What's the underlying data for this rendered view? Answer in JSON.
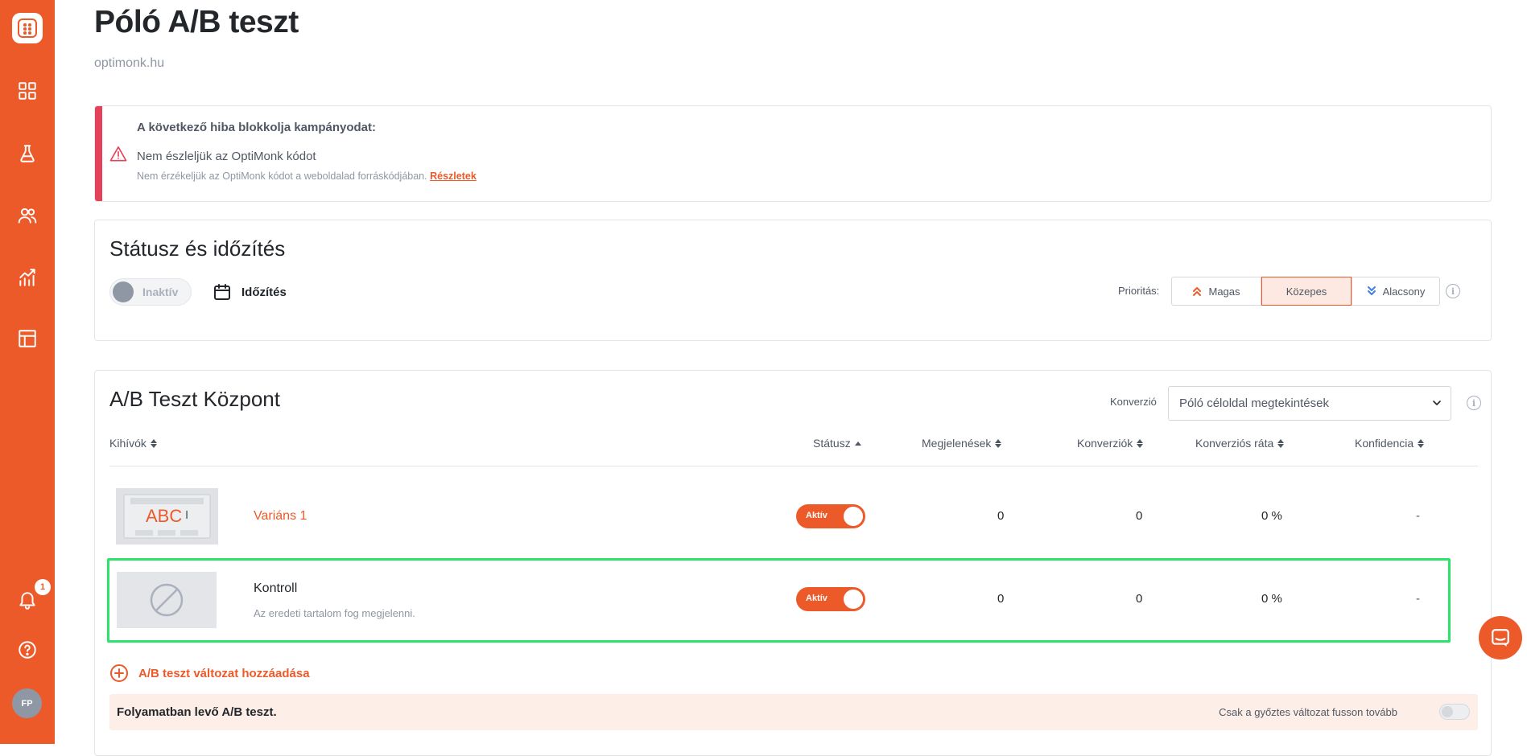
{
  "sidebar": {
    "notification_count": "1",
    "avatar_initials": "FP"
  },
  "page": {
    "title": "Póló A/B teszt",
    "domain": "optimonk.hu"
  },
  "alert": {
    "title": "A következő hiba blokkolja kampányodat:",
    "message": "Nem észleljük az OptiMonk kódot",
    "detail": "Nem érzékeljük az OptiMonk kódot a weboldalad forráskódjában.",
    "link": "Részletek"
  },
  "status_section": {
    "title": "Státusz és időzítés",
    "toggle_label": "Inaktív",
    "schedule_label": "Időzítés",
    "priority_label": "Prioritás:",
    "priority_options": [
      "Magas",
      "Közepes",
      "Alacsony"
    ],
    "priority_selected": "Közepes"
  },
  "ab_section": {
    "title": "A/B Teszt Központ",
    "conversion_label": "Konverzió",
    "conversion_value": "Póló céloldal megtekintések",
    "columns": {
      "challengers": "Kihívók",
      "status": "Státusz",
      "impressions": "Megjelenések",
      "conversions": "Konverziók",
      "conversion_rate": "Konverziós ráta",
      "confidence": "Konfidencia"
    },
    "rows": [
      {
        "name": "Variáns 1",
        "thumb_text": "ABC",
        "status": "Aktív",
        "impressions": "0",
        "conversions": "0",
        "conversion_rate": "0 %",
        "confidence": "-"
      },
      {
        "name": "Kontroll",
        "description": "Az eredeti tartalom fog megjelenni.",
        "status": "Aktív",
        "impressions": "0",
        "conversions": "0",
        "conversion_rate": "0 %",
        "confidence": "-"
      }
    ],
    "add_variant_label": "A/B teszt változat hozzáadása",
    "running_label": "Folyamatban levő A/B teszt.",
    "winner_label": "Csak a győztes változat fusson tovább"
  },
  "colors": {
    "brand": "#ed5a29",
    "error": "#e4415a",
    "highlight": "#2ee36a"
  }
}
